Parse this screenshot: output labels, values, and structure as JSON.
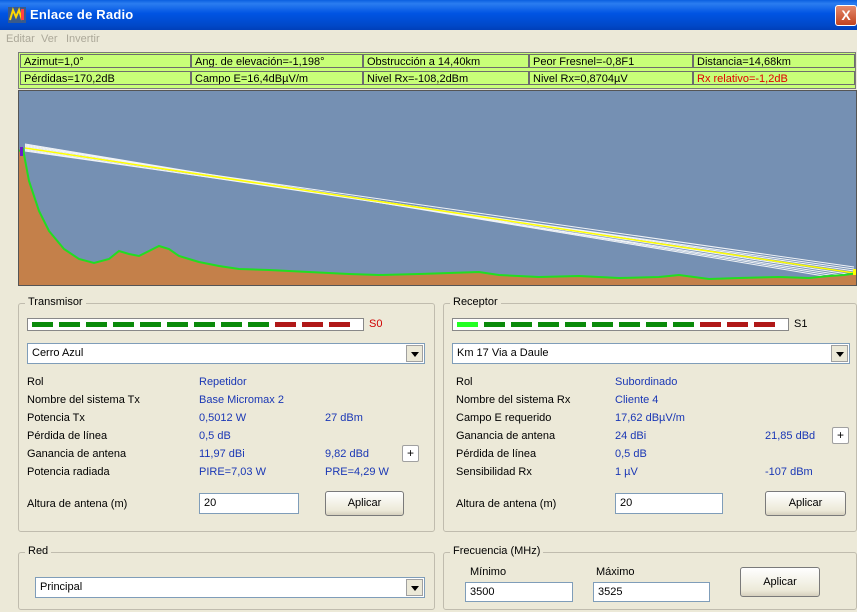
{
  "window": {
    "title": "Enlace de Radio",
    "close_glyph": "X"
  },
  "menu": [
    "Editar",
    "Ver",
    "Invertir"
  ],
  "info": {
    "row1": [
      "Azimut=1,0°",
      "Ang. de elevación=-1,198°",
      "Obstrucción a 14,40km",
      "Peor Fresnel=-0,8F1",
      "Distancia=14,68km"
    ],
    "row2": [
      "Pérdidas=170,2dB",
      "Campo E=16,4dBµV/m",
      "Nivel Rx=-108,2dBm",
      "Nivel Rx=0,8704µV",
      "Rx relativo=-1,2dB"
    ]
  },
  "transmisor": {
    "title": "Transmisor",
    "meter_label": "S0",
    "station": "Cerro Azul",
    "rows": [
      {
        "label": "Rol",
        "v1": "Repetidor",
        "v2": ""
      },
      {
        "label": "Nombre del sistema Tx",
        "v1": "Base Micromax 2",
        "v2": ""
      },
      {
        "label": "Potencia Tx",
        "v1": "0,5012 W",
        "v2": "27 dBm"
      },
      {
        "label": "Pérdida de línea",
        "v1": "0,5 dB",
        "v2": ""
      },
      {
        "label": "Ganancia de antena",
        "v1": "11,97 dBi",
        "v2": "9,82 dBd"
      },
      {
        "label": "Potencia radiada",
        "v1": "PIRE=7,03 W",
        "v2": "PRE=4,29 W"
      }
    ],
    "plus": "+",
    "altura_label": "Altura de antena (m)",
    "altura_value": "20",
    "apply": "Aplicar"
  },
  "receptor": {
    "title": "Receptor",
    "meter_label": "S1",
    "station": "Km 17 Via a Daule",
    "rows": [
      {
        "label": "Rol",
        "v1": "Subordinado",
        "v2": ""
      },
      {
        "label": "Nombre del sistema Rx",
        "v1": "Cliente 4",
        "v2": ""
      },
      {
        "label": "Campo E requerido",
        "v1": "17,62 dBµV/m",
        "v2": ""
      },
      {
        "label": "Ganancia de antena",
        "v1": "24 dBi",
        "v2": "21,85 dBd"
      },
      {
        "label": "Pérdida de línea",
        "v1": "0,5 dB",
        "v2": ""
      },
      {
        "label": "Sensibilidad Rx",
        "v1": "1 µV",
        "v2": "-107 dBm"
      }
    ],
    "plus": "+",
    "altura_label": "Altura de antena (m)",
    "altura_value": "20",
    "apply": "Aplicar"
  },
  "red": {
    "title": "Red",
    "value": "Principal"
  },
  "frecuencia": {
    "title": "Frecuencia (MHz)",
    "min_label": "Mínimo",
    "min_value": "3500",
    "max_label": "Máximo",
    "max_value": "3525",
    "apply": "Aplicar"
  },
  "colors": {
    "terrain": "#c4804a",
    "terrain_edge": "#22dd22",
    "sky": "#7590b3",
    "los": "#ffff00",
    "fresnel": "#ffffff",
    "meter_green": "#0a8a0a",
    "meter_red": "#b01818",
    "meter_active": "#22ff22"
  }
}
